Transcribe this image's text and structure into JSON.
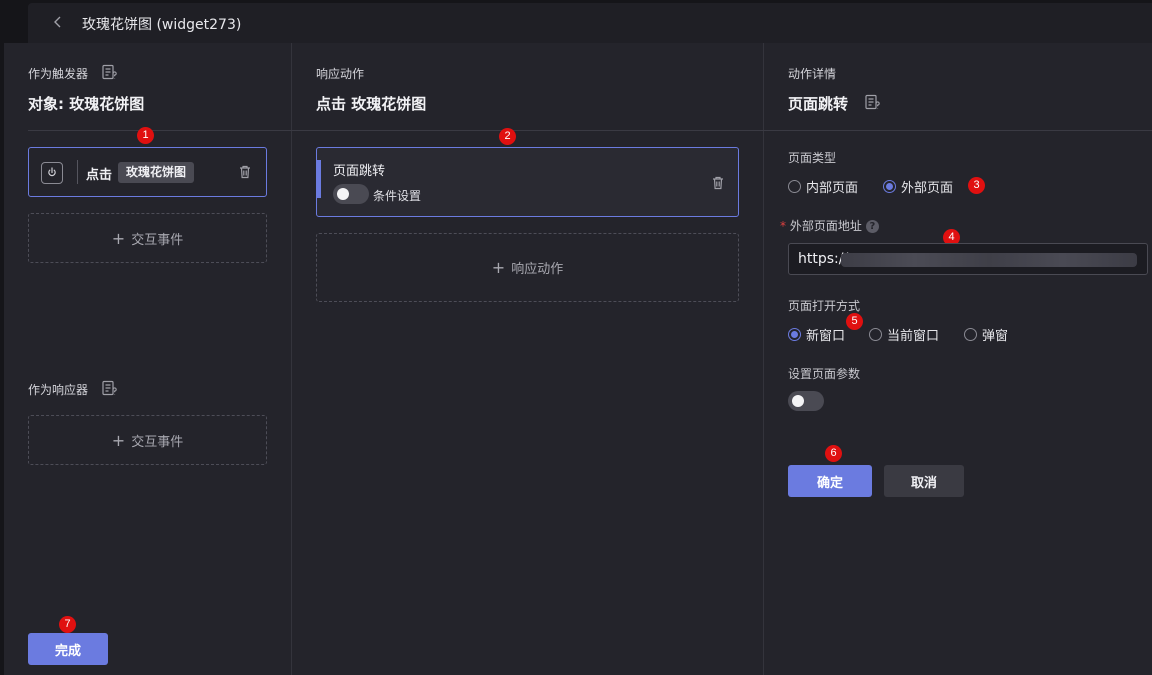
{
  "topbar": {
    "title": "玫瑰花饼图 (widget273)"
  },
  "left": {
    "trigger_label": "作为触发器",
    "object_heading": "对象: 玫瑰花饼图",
    "trigger_card": {
      "click": "点击",
      "tag": "玫瑰花饼图"
    },
    "add_event": "交互事件",
    "responder_label": "作为响应器",
    "add_event_2": "交互事件",
    "done_button": "完成"
  },
  "middle": {
    "label": "响应动作",
    "heading": "点击 玫瑰花饼图",
    "action_card": {
      "title": "页面跳转",
      "condition": "条件设置"
    },
    "add_action": "响应动作"
  },
  "right": {
    "label": "动作详情",
    "heading": "页面跳转",
    "page_type_label": "页面类型",
    "page_type_options": [
      "内部页面",
      "外部页面"
    ],
    "page_type_selected": "外部页面",
    "url_label": "外部页面地址",
    "url_prefix": "https://",
    "open_mode_label": "页面打开方式",
    "open_mode_options": [
      "新窗口",
      "当前窗口",
      "弹窗"
    ],
    "open_mode_selected": "新窗口",
    "params_label": "设置页面参数",
    "confirm_button": "确定",
    "cancel_button": "取消"
  },
  "badges": [
    "1",
    "2",
    "3",
    "4",
    "5",
    "6",
    "7"
  ],
  "colors": {
    "accent": "#6b7be0",
    "badge": "#e01010",
    "panel": "#24242b",
    "background": "#151519"
  }
}
